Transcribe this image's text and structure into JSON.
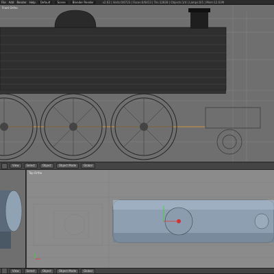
{
  "topbar": {
    "menus": [
      "File",
      "Add",
      "Render",
      "Help"
    ],
    "layout": "Default",
    "scene": "Scene",
    "engine": "Blender Render",
    "info": "v2.62 | Verts:0/6723 | Faces:0/6413 | Tris:12828 | Objects:1/4 | Lamps:0/1 | Mem:12.63M"
  },
  "top_viewport": {
    "label": "Front Ortho"
  },
  "header_top": {
    "view": "View",
    "select": "Select",
    "object": "Object",
    "mode": "Object Mode",
    "pivot": "Global"
  },
  "main_viewport": {
    "label": "Top Ortho"
  },
  "header_bottom": {
    "mode": "Object Mode",
    "global": "Global",
    "view": "View",
    "select": "Select",
    "object": "Object"
  },
  "colors": {
    "bg": "#3a3a3a",
    "viewport": "#8b8b8b",
    "selection": "#f0a030"
  }
}
